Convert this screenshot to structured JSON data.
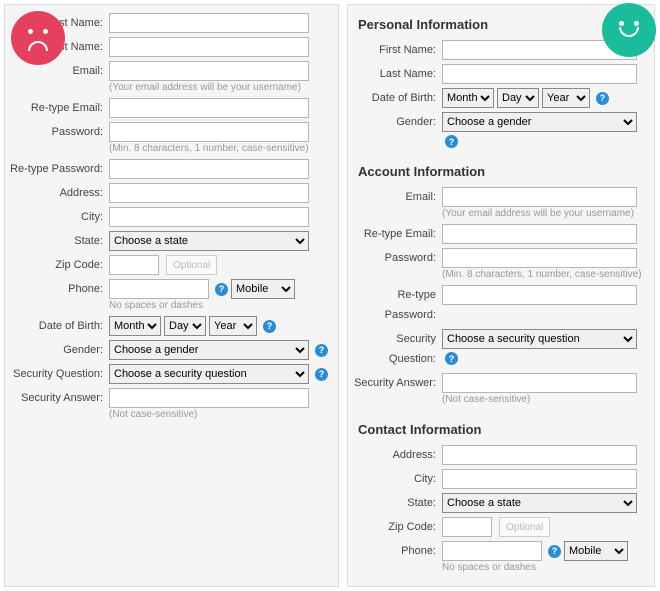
{
  "left": {
    "first_name": "First Name:",
    "last_name": "Last Name:",
    "email": "Email:",
    "email_hint": "(Your email address will be your username)",
    "retype_email": "Re-type Email:",
    "password": "Password:",
    "password_hint": "(Min. 8 characters, 1 number, case-sensitive)",
    "retype_password": "Re-type Password:",
    "address": "Address:",
    "city": "City:",
    "state": "State:",
    "state_placeholder": "Choose a state",
    "zip": "Zip Code:",
    "optional": "Optional",
    "phone": "Phone:",
    "phone_hint": "No spaces or dashes",
    "mobile": "Mobile",
    "dob": "Date of Birth:",
    "month": "Month",
    "day": "Day",
    "year": "Year",
    "gender": "Gender:",
    "gender_placeholder": "Choose a gender",
    "secq": "Security Question:",
    "secq_placeholder": "Choose a security question",
    "seca": "Security Answer:",
    "seca_hint": "(Not case-sensitive)",
    "help": "?"
  },
  "right": {
    "personal_title": "Personal Information",
    "first_name": "First Name:",
    "last_name": "Last Name:",
    "dob": "Date of Birth:",
    "month": "Month",
    "day": "Day",
    "year": "Year",
    "gender": "Gender:",
    "gender_placeholder": "Choose a gender",
    "account_title": "Account Information",
    "email": "Email:",
    "email_hint": "(Your email address will be your username)",
    "retype_email": "Re-type Email:",
    "password": "Password:",
    "password_hint": "(Min. 8 characters, 1 number, case-sensitive)",
    "retype_password": "Re-type Password:",
    "secq": "Security Question:",
    "secq_placeholder": "Choose a security question",
    "seca": "Security Answer:",
    "seca_hint": "(Not case-sensitive)",
    "contact_title": "Contact Information",
    "address": "Address:",
    "city": "City:",
    "state": "State:",
    "state_placeholder": "Choose a state",
    "zip": "Zip Code:",
    "optional": "Optional",
    "phone": "Phone:",
    "phone_hint": "No spaces or dashes",
    "mobile": "Mobile",
    "help": "?"
  }
}
